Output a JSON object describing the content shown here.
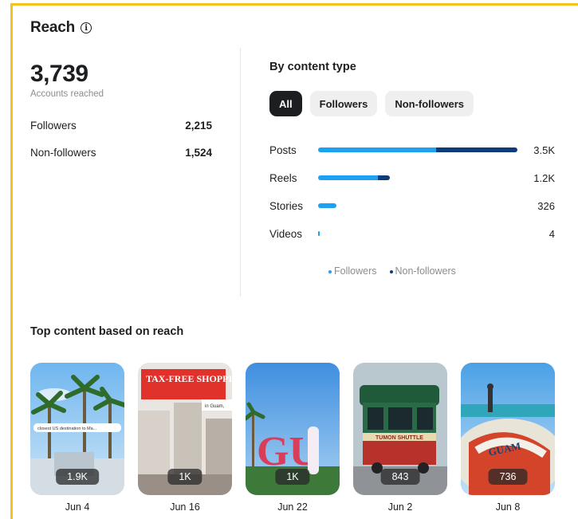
{
  "title": "Reach",
  "summary": {
    "total": "3,739",
    "total_label": "Accounts reached"
  },
  "breakdown": [
    {
      "label": "Followers",
      "value": "2,215"
    },
    {
      "label": "Non-followers",
      "value": "1,524"
    }
  ],
  "content_type": {
    "title": "By content type",
    "filters": [
      "All",
      "Followers",
      "Non-followers"
    ],
    "active_filter": "All",
    "rows": [
      {
        "label": "Posts",
        "value": "3.5K",
        "followers_fraction": 0.59,
        "nonfollowers_fraction": 0.41
      },
      {
        "label": "Reels",
        "value": "1.2K",
        "followers_fraction": 0.3,
        "nonfollowers_fraction": 0.06
      },
      {
        "label": "Stories",
        "value": "326",
        "followers_fraction": 0.09,
        "nonfollowers_fraction": 0.0
      },
      {
        "label": "Videos",
        "value": "4",
        "followers_fraction": 0.005,
        "nonfollowers_fraction": 0.0
      }
    ],
    "legend": [
      "Followers",
      "Non-followers"
    ],
    "colors": {
      "followers": "#1da1f2",
      "nonfollowers": "#0e3c78"
    }
  },
  "top_content": {
    "title": "Top content based on reach",
    "items": [
      {
        "count": "1.9K",
        "date": "Jun 4",
        "thumb_text": "closest US destination to Ma..."
      },
      {
        "count": "1K",
        "date": "Jun 16",
        "thumb_text": "TAX-FREE SHOPPING",
        "thumb_sub": "in Guam,"
      },
      {
        "count": "1K",
        "date": "Jun 22",
        "thumb_text": "GU"
      },
      {
        "count": "843",
        "date": "Jun 2",
        "thumb_text": "TUMON SHUTTLE"
      },
      {
        "count": "736",
        "date": "Jun 8",
        "thumb_text": "GUAM"
      }
    ]
  }
}
